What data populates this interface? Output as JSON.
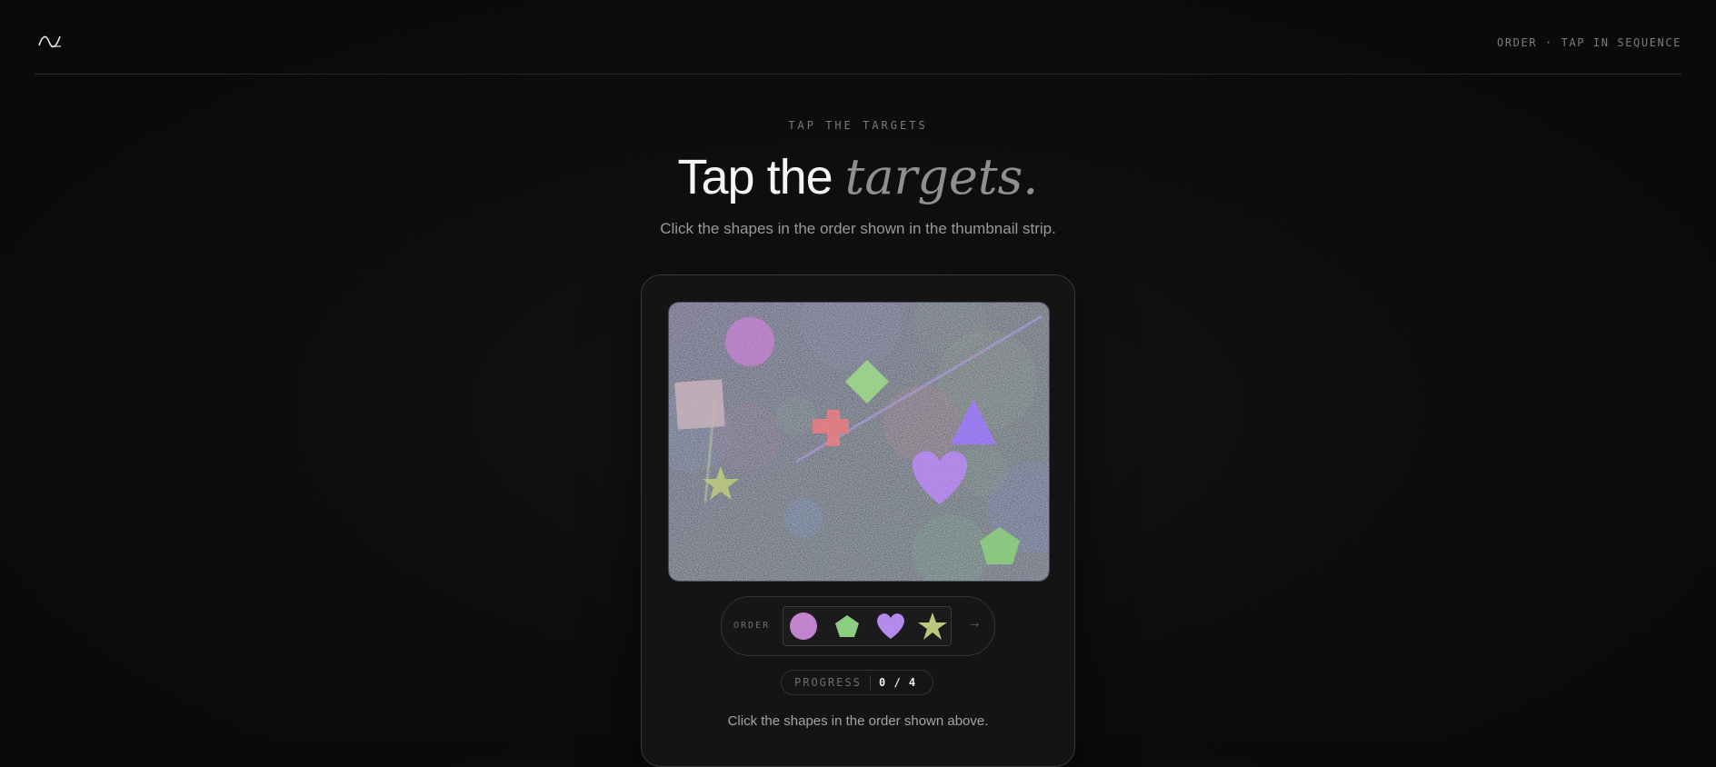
{
  "header": {
    "logo_icon": "wave-logo-icon",
    "mode_label": "ORDER · TAP IN SEQUENCE"
  },
  "hero": {
    "eyebrow": "TAP THE TARGETS",
    "title_plain": "Tap the ",
    "title_emphasis": "targets.",
    "subtitle": "Click the shapes in the order shown in the thumbnail strip."
  },
  "puzzle": {
    "targets": [
      {
        "name": "circle",
        "color": "#b04ac0"
      },
      {
        "name": "diamond",
        "color": "#7ed25a"
      },
      {
        "name": "square",
        "color": "#b89aa8"
      },
      {
        "name": "cross",
        "color": "#e03a4a"
      },
      {
        "name": "triangle",
        "color": "#7a30f0"
      },
      {
        "name": "heart",
        "color": "#a058e8"
      },
      {
        "name": "star",
        "color": "#a8b83a"
      },
      {
        "name": "pentagon",
        "color": "#5cc040"
      }
    ],
    "order_label": "ORDER",
    "order_sequence": [
      "circle",
      "pentagon",
      "heart",
      "star"
    ],
    "next_icon": "arrow-right-icon",
    "next_label": "→",
    "progress_label": "PROGRESS",
    "progress_value": "0 / 4",
    "instructions": "Click the shapes in the order shown above."
  }
}
